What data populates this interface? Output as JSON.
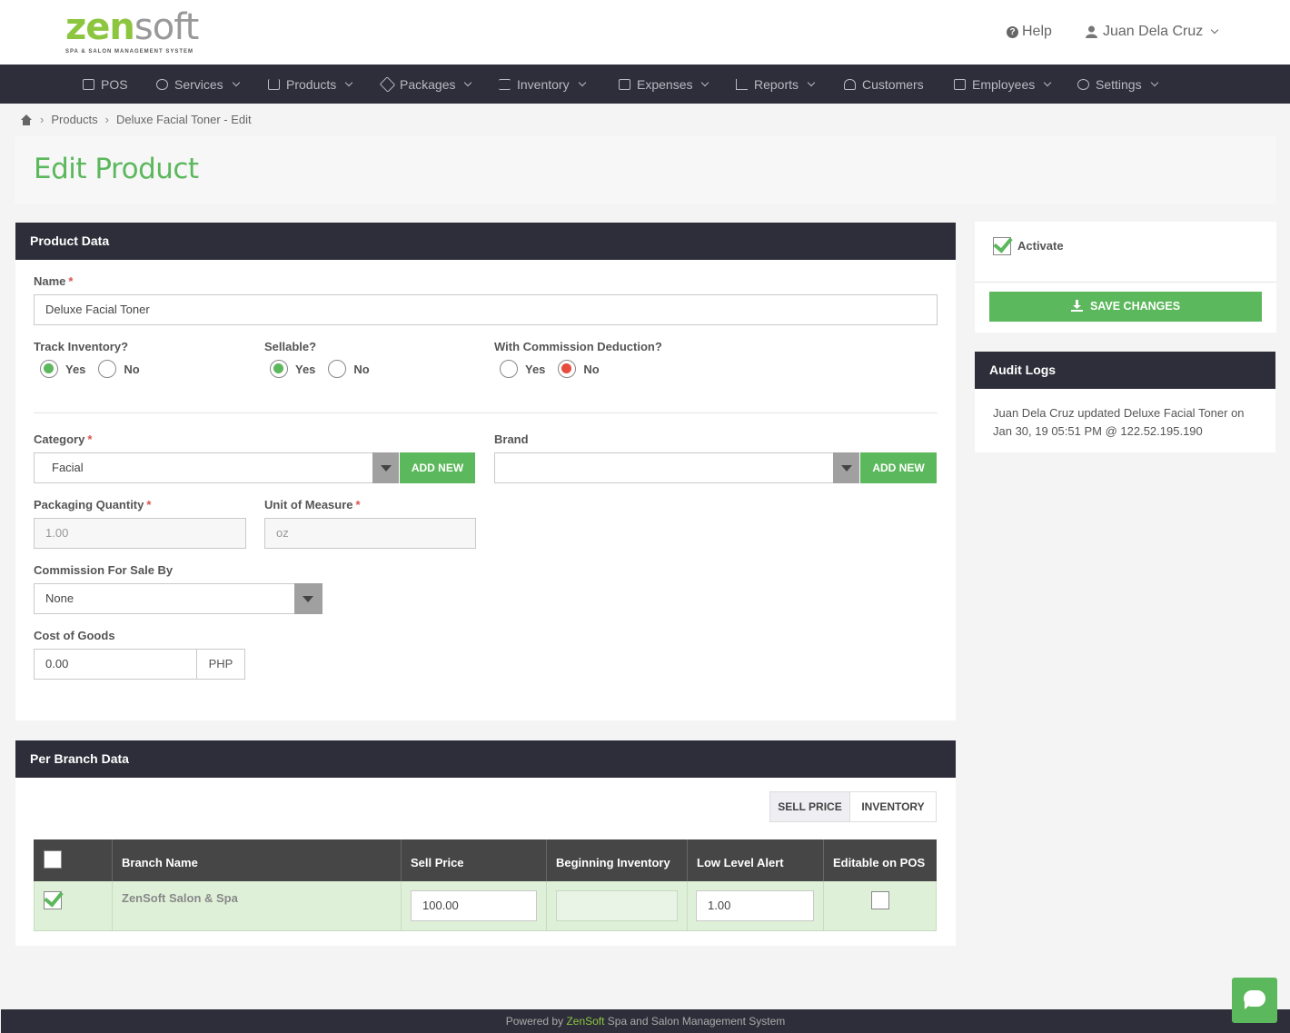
{
  "header": {
    "logo_main": "zen",
    "logo_soft": "soft",
    "logo_tag": "SPA & SALON MANAGEMENT SYSTEM",
    "help_label": "Help",
    "user_name": "Juan Dela Cruz"
  },
  "nav": {
    "items": [
      {
        "label": "POS",
        "icon": "register-icon"
      },
      {
        "label": "Services",
        "icon": "hand-icon"
      },
      {
        "label": "Products",
        "icon": "cart-icon"
      },
      {
        "label": "Packages",
        "icon": "tags-icon"
      },
      {
        "label": "Inventory",
        "icon": "list-icon"
      },
      {
        "label": "Expenses",
        "icon": "chart-icon"
      },
      {
        "label": "Reports",
        "icon": "bar-chart-icon"
      },
      {
        "label": "Customers",
        "icon": "users-icon"
      },
      {
        "label": "Employees",
        "icon": "briefcase-icon"
      },
      {
        "label": "Settings",
        "icon": "gear-icon"
      }
    ]
  },
  "breadcrumb": {
    "home_icon": "home-icon",
    "items": [
      "Products",
      "Deluxe Facial Toner - Edit"
    ],
    "separator": "›"
  },
  "page": {
    "title": "Edit Product"
  },
  "product_data": {
    "header": "Product Data",
    "name_label": "Name",
    "name_value": "Deluxe Facial Toner",
    "track_inventory_label": "Track Inventory?",
    "sellable_label": "Sellable?",
    "commission_deduction_label": "With Commission Deduction?",
    "yes": "Yes",
    "no": "No",
    "track_inventory_value": "Yes",
    "sellable_value": "Yes",
    "commission_deduction_value": "No",
    "category_label": "Category",
    "category_value": "Facial",
    "brand_label": "Brand",
    "brand_value": "",
    "add_new": "ADD NEW",
    "packaging_quantity_label": "Packaging Quantity",
    "packaging_quantity_value": "1.00",
    "unit_label": "Unit of Measure",
    "unit_value": "oz",
    "commission_for_sale_label": "Commission For Sale By",
    "commission_for_sale_value": "None",
    "cost_label": "Cost of Goods",
    "cost_value": "0.00",
    "currency": "PHP",
    "required_mark": "*"
  },
  "sidebar": {
    "activate_label": "Activate",
    "activate_checked": true,
    "save_label": "SAVE CHANGES",
    "audit_header": "Audit Logs",
    "audit_line1": "Juan Dela Cruz updated Deluxe Facial Toner on",
    "audit_line2": "Jan 30, 19 05:51 PM @ 122.52.195.190"
  },
  "branch": {
    "header": "Per Branch Data",
    "tabs": [
      "SELL PRICE",
      "INVENTORY"
    ],
    "active_tab": "SELL PRICE",
    "columns": [
      "",
      "Branch Name",
      "Sell Price",
      "Beginning Inventory",
      "Low Level Alert",
      "Editable on POS"
    ],
    "rows": [
      {
        "selected": true,
        "branch_name": "ZenSoft Salon & Spa",
        "sell_price": "100.00",
        "beginning_inventory": "",
        "low_level_alert": "1.00",
        "editable_on_pos": false
      }
    ]
  },
  "footer": {
    "prefix": "Powered by ",
    "brand": "ZenSoft",
    "suffix": " Spa and Salon Management System"
  },
  "colors": {
    "accent_green": "#5cb85c",
    "nav_dark": "#2e2e3a",
    "required_red": "#d9534f"
  }
}
